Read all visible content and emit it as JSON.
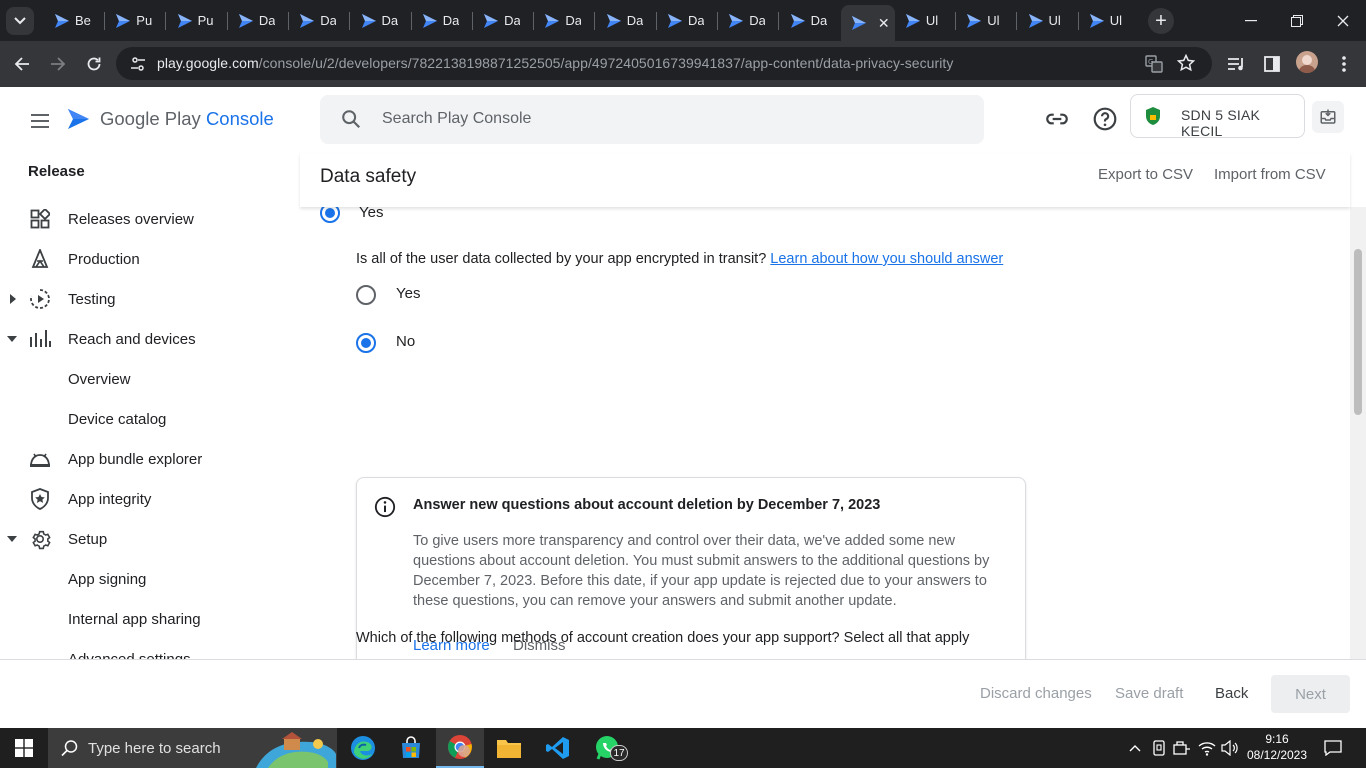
{
  "browser": {
    "tabs": [
      {
        "title": "Be",
        "active": false
      },
      {
        "title": "Pu",
        "active": false
      },
      {
        "title": "Pu",
        "active": false
      },
      {
        "title": "Da",
        "active": false
      },
      {
        "title": "Da",
        "active": false
      },
      {
        "title": "Da",
        "active": false
      },
      {
        "title": "Da",
        "active": false
      },
      {
        "title": "Da",
        "active": false
      },
      {
        "title": "Da",
        "active": false
      },
      {
        "title": "Da",
        "active": false
      },
      {
        "title": "Da",
        "active": false
      },
      {
        "title": "Da",
        "active": false
      },
      {
        "title": "Da",
        "active": false
      },
      {
        "title": "",
        "active": true
      },
      {
        "title": "Ul",
        "active": false
      },
      {
        "title": "Ul",
        "active": false
      },
      {
        "title": "Ul",
        "active": false
      },
      {
        "title": "Ul",
        "active": false
      }
    ],
    "url_host": "play.google.com",
    "url_path": "/console/u/2/developers/7822138198871252505/app/4972405016739941837/app-content/data-privacy-security"
  },
  "header": {
    "logo_text_google": "Google Play",
    "logo_text_console": "Console",
    "search_placeholder": "Search Play Console",
    "account_name": "SDN 5 SIAK KECIL"
  },
  "sidebar": {
    "section": "Release",
    "items": [
      {
        "label": "Releases overview",
        "icon": "dashboard-icon"
      },
      {
        "label": "Production",
        "icon": "production-icon"
      },
      {
        "label": "Testing",
        "icon": "testing-icon",
        "expander": "collapsed"
      },
      {
        "label": "Reach and devices",
        "icon": "reach-devices-icon",
        "expander": "expanded"
      },
      {
        "label": "Overview",
        "icon": ""
      },
      {
        "label": "Device catalog",
        "icon": ""
      },
      {
        "label": "App bundle explorer",
        "icon": "app-bundle-icon"
      },
      {
        "label": "App integrity",
        "icon": "shield-icon"
      },
      {
        "label": "Setup",
        "icon": "gear-icon",
        "expander": "expanded"
      },
      {
        "label": "App signing",
        "icon": ""
      },
      {
        "label": "Internal app sharing",
        "icon": ""
      },
      {
        "label": "Advanced settings",
        "icon": ""
      }
    ]
  },
  "content": {
    "title": "Data safety",
    "export_csv": "Export to CSV",
    "import_csv": "Import from CSV",
    "prev_answer_yes": "Yes",
    "question_encrypted": "Is all of the user data collected by your app encrypted in transit?",
    "question_encrypted_link": "Learn about how you should answer",
    "option_yes": "Yes",
    "option_no": "No",
    "selected_option": "No",
    "notice": {
      "title": "Answer new questions about account deletion by December 7, 2023",
      "body": "To give users more transparency and control over their data, we've added some new questions about account deletion. You must submit answers to the additional questions by December 7, 2023. Before this date, if your app update is rejected due to your answers to these questions, you can remove your answers and submit another update.",
      "learn_more": "Learn more",
      "dismiss": "Dismiss"
    },
    "question_account_creation": "Which of the following methods of account creation does your app support? Select all that apply"
  },
  "footer": {
    "discard": "Discard changes",
    "save_draft": "Save draft",
    "back": "Back",
    "next": "Next"
  },
  "taskbar": {
    "search_placeholder": "Type here to search",
    "whatsapp_badge": "17",
    "time": "9:16",
    "date": "08/12/2023"
  },
  "colors": {
    "accent": "#1a73e8",
    "chrome_dark": "#202124",
    "chrome_toolbar": "#35363a"
  }
}
